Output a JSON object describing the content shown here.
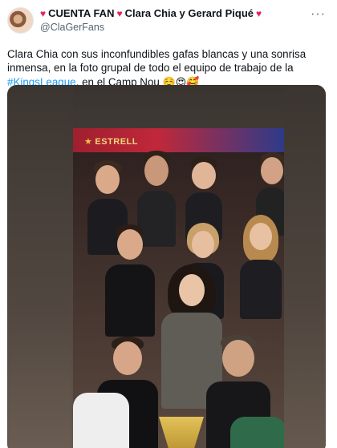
{
  "account": {
    "display_name_prefix": "CUENTA FAN",
    "display_name_suffix": "Clara Chia y Gerard Piqué",
    "heart": "♥",
    "handle": "@ClaGerFans"
  },
  "tweet": {
    "text_part1": "Clara Chia con sus inconfundibles gafas blancas y una sonrisa inmensa, en la foto grupal de todo el equipo de trabajo de la ",
    "hashtag": "#KingsLeague",
    "text_part2": ", en el Camp Nou ",
    "emojis": "☺️😍🥰"
  },
  "media": {
    "banner_text": "ESTRELL"
  },
  "colors": {
    "accent": "#1d9bf0",
    "heart": "#e0245e",
    "muted": "#536471"
  },
  "icons": {
    "more": "more-options-icon",
    "heart": "heart-icon",
    "star": "star-icon"
  }
}
